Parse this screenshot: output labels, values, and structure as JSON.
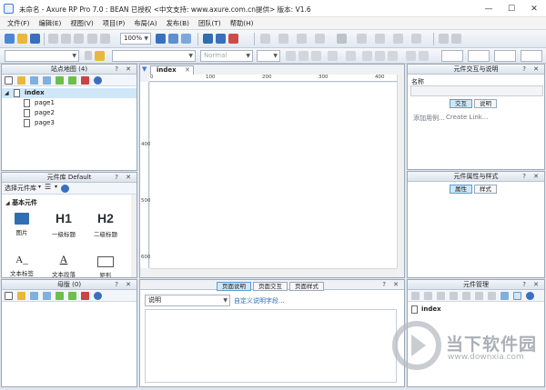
{
  "window": {
    "title": "未命名 - Axure RP Pro 7.0 : BEAN 已授权      <中文支持: www.axure.com.cn提供> 版本: V1.6",
    "minimize": "—",
    "maximize": "☐",
    "close": "✕"
  },
  "menu": [
    "文件(F)",
    "编辑(E)",
    "视图(V)",
    "项目(P)",
    "布局(A)",
    "发布(B)",
    "团队(T)",
    "帮助(H)"
  ],
  "toolbar": {
    "zoom": "100%",
    "style": "Normal"
  },
  "sitemap": {
    "title": "站点地图 (4)",
    "root": "index",
    "pages": [
      "page1",
      "page2",
      "page3"
    ]
  },
  "library": {
    "title": "元件库 Default",
    "select_label": "选择元件库",
    "section": "基本元件",
    "items": [
      {
        "glyph": "",
        "label": "图片"
      },
      {
        "glyph": "H1",
        "label": "一级标题"
      },
      {
        "glyph": "H2",
        "label": "二级标题"
      },
      {
        "glyph": "A_",
        "label": "文本标签"
      },
      {
        "glyph": "A",
        "label": "文本段落"
      },
      {
        "glyph": "",
        "label": "矩形"
      }
    ]
  },
  "masters": {
    "title": "母版 (0)"
  },
  "canvas": {
    "tab": "index",
    "ruler_h": [
      "0",
      "100",
      "200",
      "300",
      "400"
    ],
    "ruler_v": [
      "400",
      "500",
      "600"
    ]
  },
  "page_props": {
    "tabs": [
      "页面说明",
      "页面交互",
      "页面样式"
    ],
    "active_tab": 0,
    "select_value": "说明",
    "custom_link": "自定义说明字段..."
  },
  "interaction": {
    "title": "元件交互与说明",
    "name_label": "名称",
    "tabs": [
      "交互",
      "说明"
    ],
    "add_case": "添加用例...",
    "create_link": "Create Link..."
  },
  "properties": {
    "title": "元件属性与样式",
    "tabs": [
      "属性",
      "样式"
    ]
  },
  "widget_manager": {
    "title": "元件管理",
    "item": "index"
  },
  "watermark": {
    "cn": "当下软件园",
    "url": "www.downxia.com"
  },
  "colors": {
    "accent": "#3d7bd8",
    "selection": "#cfe7f7",
    "panel_border": "#9ea9b7"
  }
}
